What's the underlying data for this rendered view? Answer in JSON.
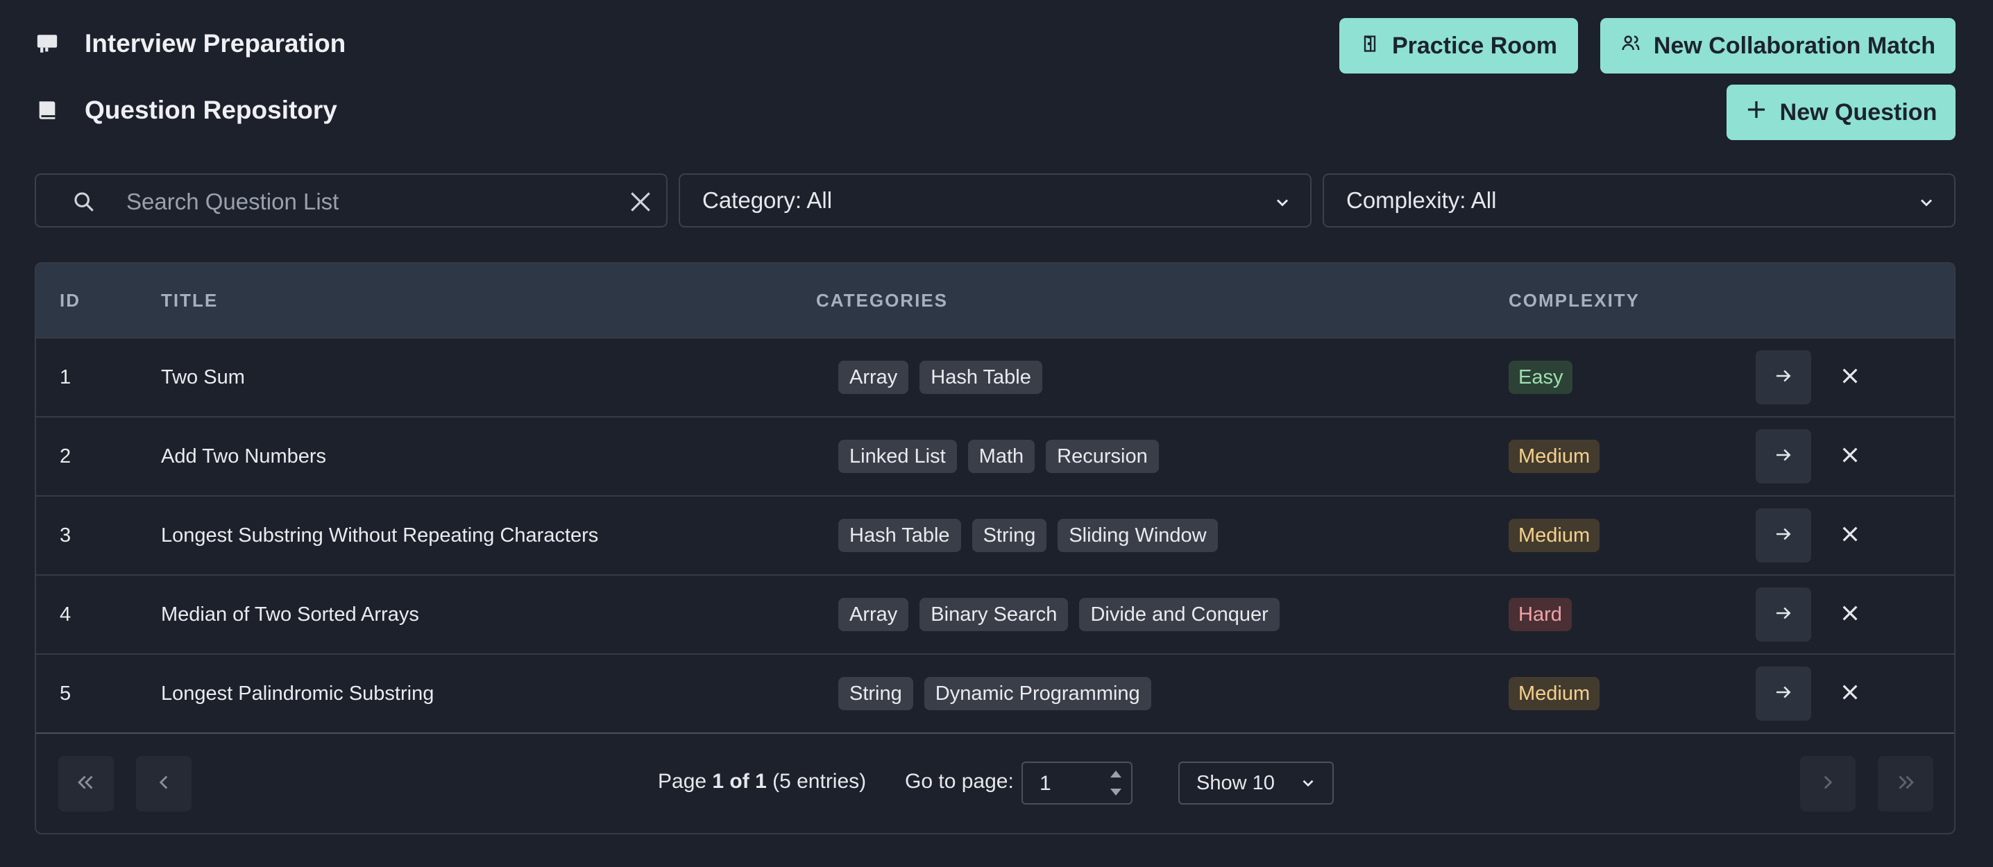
{
  "header": {
    "title": "Interview Preparation",
    "subtitle": "Question Repository",
    "practice_room": "Practice Room",
    "new_match": "New Collaboration Match",
    "new_question": "New Question"
  },
  "filters": {
    "search_placeholder": "Search Question List",
    "category": "Category: All",
    "complexity": "Complexity: All"
  },
  "table": {
    "headers": {
      "id": "ID",
      "title": "TITLE",
      "categories": "CATEGORIES",
      "complexity": "COMPLEXITY"
    },
    "rows": [
      {
        "id": "1",
        "title": "Two Sum",
        "tags": [
          "Array",
          "Hash Table"
        ],
        "complexity": "Easy"
      },
      {
        "id": "2",
        "title": "Add Two Numbers",
        "tags": [
          "Linked List",
          "Math",
          "Recursion"
        ],
        "complexity": "Medium"
      },
      {
        "id": "3",
        "title": "Longest Substring Without Repeating Characters",
        "tags": [
          "Hash Table",
          "String",
          "Sliding Window"
        ],
        "complexity": "Medium"
      },
      {
        "id": "4",
        "title": "Median of Two Sorted Arrays",
        "tags": [
          "Array",
          "Binary Search",
          "Divide and Conquer"
        ],
        "complexity": "Hard"
      },
      {
        "id": "5",
        "title": "Longest Palindromic Substring",
        "tags": [
          "String",
          "Dynamic Programming"
        ],
        "complexity": "Medium"
      }
    ]
  },
  "pagination": {
    "page_prefix": "Page ",
    "page_current": "1 of 1",
    "entries": " (5 entries)",
    "goto_label": "Go to page:",
    "goto_value": "1",
    "show": "Show 10"
  },
  "colors": {
    "accent": "#8ee1d3",
    "background": "#1d212b",
    "header_row": "#2e3746"
  }
}
